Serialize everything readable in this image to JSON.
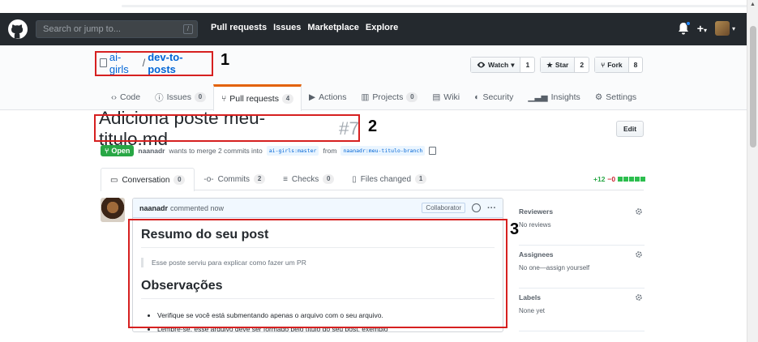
{
  "header": {
    "search_placeholder": "Search or jump to...",
    "search_key": "/",
    "nav": [
      "Pull requests",
      "Issues",
      "Marketplace",
      "Explore"
    ],
    "plus": "+",
    "caret": "▾"
  },
  "repo": {
    "owner": "ai-girls",
    "separator": "/",
    "name": "dev-to-posts",
    "watch": {
      "label": "Watch",
      "count": "1"
    },
    "star": {
      "label": "Star",
      "count": "2"
    },
    "fork": {
      "label": "Fork",
      "count": "8"
    },
    "tabs": [
      {
        "label": "Code"
      },
      {
        "label": "Issues",
        "count": "0"
      },
      {
        "label": "Pull requests",
        "count": "4"
      },
      {
        "label": "Actions"
      },
      {
        "label": "Projects",
        "count": "0"
      },
      {
        "label": "Wiki"
      },
      {
        "label": "Security"
      },
      {
        "label": "Insights"
      },
      {
        "label": "Settings"
      }
    ]
  },
  "pr": {
    "title": "Adiciona poste meu-titulo.md",
    "number": "#7",
    "edit_label": "Edit",
    "state": "Open",
    "author": "naanadr",
    "meta_text1": "wants to merge 2 commits into",
    "base_branch": "ai-girls:master",
    "meta_text2": "from",
    "head_branch": "naanadr:meu-titulo-branch",
    "tabs": [
      {
        "label": "Conversation",
        "count": "0"
      },
      {
        "label": "Commits",
        "count": "2"
      },
      {
        "label": "Checks",
        "count": "0"
      },
      {
        "label": "Files changed",
        "count": "1"
      }
    ],
    "diff_add": "+12",
    "diff_del": "−0"
  },
  "comment": {
    "author": "naanadr",
    "action": "commented now",
    "badge": "Collaborator",
    "dots": "···",
    "h1": "Resumo do seu post",
    "quote": "Esse poste serviu para explicar como fazer um PR",
    "h2": "Observações",
    "items": [
      "Verifique se você está submentando apenas o arquivo com o seu arquivo.",
      "Lembre-se, esse arquivo deve ser formado pelo título do seu post, exemplo"
    ]
  },
  "sidebar": {
    "reviewers": {
      "title": "Reviewers",
      "value": "No reviews"
    },
    "assignees": {
      "title": "Assignees",
      "value": "No one—assign yourself"
    },
    "labels": {
      "title": "Labels",
      "value": "None yet"
    }
  },
  "annotations": [
    "1",
    "2",
    "3"
  ],
  "colors": {
    "annotation": "#d62020",
    "open": "#28a745",
    "tab_accent": "#e36209",
    "link": "#0366d6"
  }
}
